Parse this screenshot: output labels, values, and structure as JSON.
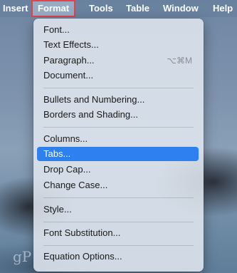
{
  "menubar": {
    "items": [
      {
        "label": "Insert"
      },
      {
        "label": "Format"
      },
      {
        "label": "Tools"
      },
      {
        "label": "Table"
      },
      {
        "label": "Window"
      },
      {
        "label": "Help"
      }
    ]
  },
  "menu": {
    "items": [
      {
        "label": "Font..."
      },
      {
        "label": "Text Effects..."
      },
      {
        "label": "Paragraph...",
        "shortcut": "⌥⌘M"
      },
      {
        "label": "Document..."
      },
      {
        "label": "Bullets and Numbering..."
      },
      {
        "label": "Borders and Shading..."
      },
      {
        "label": "Columns..."
      },
      {
        "label": "Tabs...",
        "selected": true
      },
      {
        "label": "Drop Cap..."
      },
      {
        "label": "Change Case..."
      },
      {
        "label": "Style..."
      },
      {
        "label": "Font Substitution..."
      },
      {
        "label": "Equation Options..."
      }
    ]
  },
  "watermark": "gP",
  "colors": {
    "highlight": "#2e7ff0",
    "active_outline": "#e0434a"
  }
}
